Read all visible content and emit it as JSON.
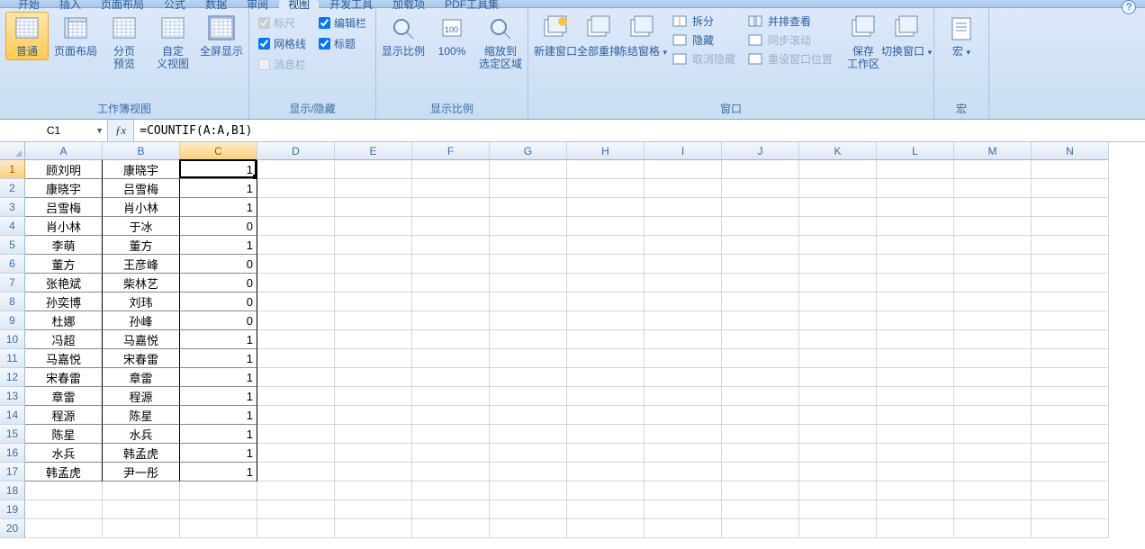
{
  "tabs": [
    "开始",
    "插入",
    "页面布局",
    "公式",
    "数据",
    "审阅",
    "视图",
    "开发工具",
    "加载项",
    "PDF工具集"
  ],
  "activeTab": 6,
  "ribbon": {
    "g1": {
      "label": "工作簿视图",
      "btns": [
        {
          "name": "normal-view-button",
          "label": "普通",
          "sel": true
        },
        {
          "name": "page-layout-button",
          "label": "页面布局"
        },
        {
          "name": "page-break-preview-button",
          "label": "分页\n预览"
        },
        {
          "name": "custom-views-button",
          "label": "自定\n义视图"
        },
        {
          "name": "fullscreen-button",
          "label": "全屏显示"
        }
      ]
    },
    "g2": {
      "label": "显示/隐藏",
      "checks": [
        {
          "name": "ruler-check",
          "label": "标尺",
          "on": true,
          "dis": true
        },
        {
          "name": "gridlines-check",
          "label": "网格线",
          "on": true
        },
        {
          "name": "messagebar-check",
          "label": "消息栏",
          "on": false,
          "dis": true
        },
        {
          "name": "formulabar-check",
          "label": "编辑栏",
          "on": true
        },
        {
          "name": "headings-check",
          "label": "标题",
          "on": true
        }
      ]
    },
    "g3": {
      "label": "显示比例",
      "btns": [
        {
          "name": "zoom-button",
          "label": "显示比例"
        },
        {
          "name": "zoom-100-button",
          "label": "100%"
        },
        {
          "name": "zoom-selection-button",
          "label": "缩放到\n选定区域"
        }
      ]
    },
    "g4": {
      "label": "窗口",
      "btns": [
        {
          "name": "new-window-button",
          "label": "新建窗口"
        },
        {
          "name": "arrange-all-button",
          "label": "全部重排"
        },
        {
          "name": "freeze-panes-button",
          "label": "冻结窗格",
          "dd": true
        }
      ],
      "smalls": [
        {
          "name": "split-button",
          "label": "拆分",
          "icon": "split"
        },
        {
          "name": "hide-button",
          "label": "隐藏",
          "icon": "hide"
        },
        {
          "name": "unhide-button",
          "label": "取消隐藏",
          "icon": "unhide",
          "dis": true
        }
      ],
      "smalls2": [
        {
          "name": "view-side-by-side-button",
          "label": "并排查看",
          "icon": "sidebyside"
        },
        {
          "name": "sync-scroll-button",
          "label": "同步滚动",
          "icon": "sync",
          "dis": true
        },
        {
          "name": "reset-window-pos-button",
          "label": "重设窗口位置",
          "icon": "reset",
          "dis": true
        }
      ],
      "btns2": [
        {
          "name": "save-workspace-button",
          "label": "保存\n工作区"
        },
        {
          "name": "switch-windows-button",
          "label": "切换窗口",
          "dd": true
        }
      ]
    },
    "g5": {
      "label": "宏",
      "btns": [
        {
          "name": "macros-button",
          "label": "宏",
          "dd": true
        }
      ]
    }
  },
  "namebox": "C1",
  "formula": "=COUNTIF(A:A,B1)",
  "columns": [
    "A",
    "B",
    "C",
    "D",
    "E",
    "F",
    "G",
    "H",
    "I",
    "J",
    "K",
    "L",
    "M",
    "N"
  ],
  "activeCol": 2,
  "activeRow": 0,
  "chart_data": {
    "type": "table",
    "columns": [
      "A",
      "B",
      "C"
    ],
    "rows": [
      [
        "顾刘明",
        "康晓宇",
        1
      ],
      [
        "康晓宇",
        "吕雪梅",
        1
      ],
      [
        "吕雪梅",
        "肖小林",
        1
      ],
      [
        "肖小林",
        "于冰",
        0
      ],
      [
        "李萌",
        "董方",
        1
      ],
      [
        "董方",
        "王彦峰",
        0
      ],
      [
        "张艳斌",
        "柴林艺",
        0
      ],
      [
        "孙奕博",
        "刘玮",
        0
      ],
      [
        "杜娜",
        "孙峰",
        0
      ],
      [
        "冯超",
        "马嘉悦",
        1
      ],
      [
        "马嘉悦",
        "宋春雷",
        1
      ],
      [
        "宋春雷",
        "章雷",
        1
      ],
      [
        "章雷",
        "程源",
        1
      ],
      [
        "程源",
        "陈星",
        1
      ],
      [
        "陈星",
        "水兵",
        1
      ],
      [
        "水兵",
        "韩孟虎",
        1
      ],
      [
        "韩孟虎",
        "尹一彤",
        1
      ]
    ]
  }
}
